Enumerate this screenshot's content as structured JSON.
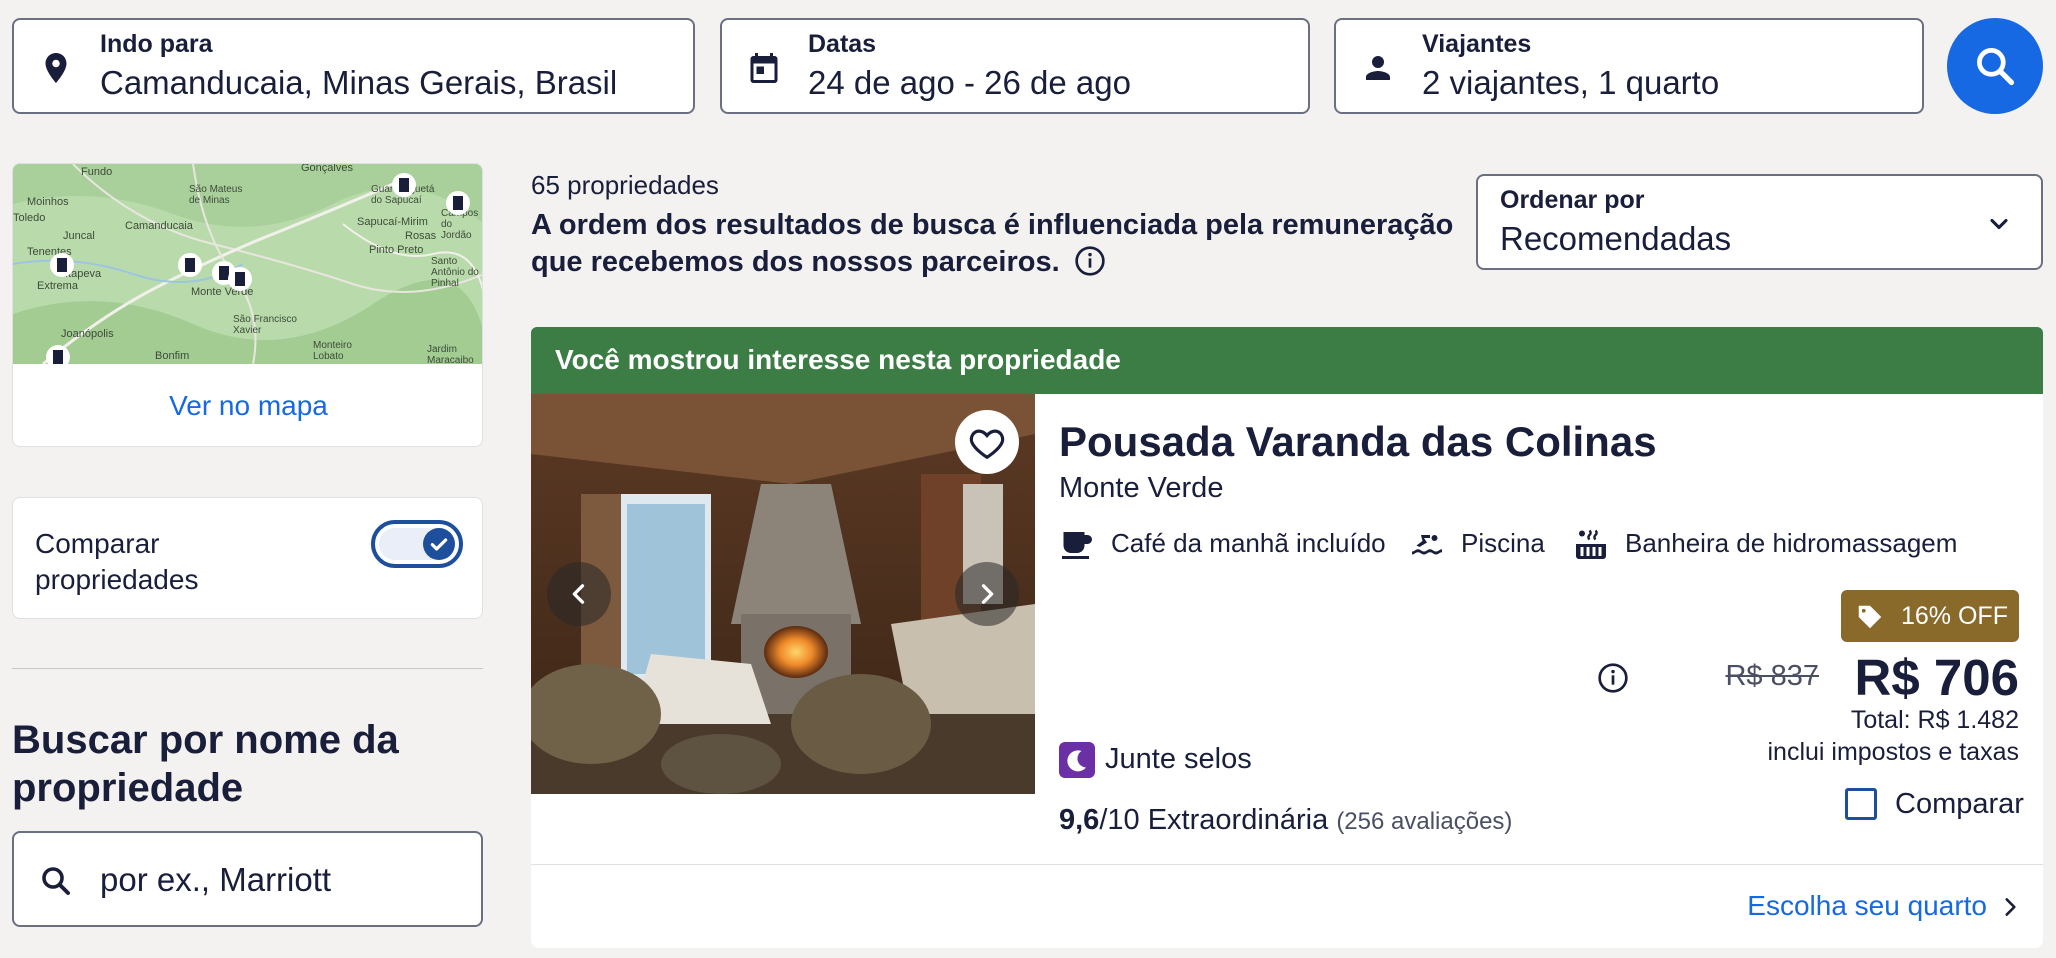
{
  "search": {
    "destination": {
      "label": "Indo para",
      "value": "Camanducaia, Minas Gerais, Brasil",
      "icon": "location-pin-icon"
    },
    "dates": {
      "label": "Datas",
      "value": "24 de ago - 26 de ago",
      "icon": "calendar-icon"
    },
    "travelers": {
      "label": "Viajantes",
      "value": "2 viajantes, 1 quarto",
      "icon": "person-icon"
    },
    "submit_icon": "search-icon"
  },
  "sidebar": {
    "map": {
      "link_label": "Ver no mapa",
      "places": [
        "Fundo",
        "Gonçalves",
        "São Mateus de Minas",
        "Campos do Jordão",
        "Moinhos",
        "Camanducaia",
        "Sapucaí-Mirim",
        "Rosas",
        "Toledo",
        "Juncal",
        "Pinto Preto",
        "Santo Antônio do Pinhal",
        "Tenentes",
        "Extrema",
        "Itapeva",
        "Monte Verde",
        "Joanópolis",
        "São Francisco Xavier",
        "Monteiro Lobato",
        "Jardim Maracaibo",
        "Bonfim",
        "Guaratinguetá do Sapucaí"
      ]
    },
    "compare": {
      "label": "Comparar propriedades",
      "enabled": true
    },
    "name_search": {
      "title": "Buscar por nome da propriedade",
      "placeholder": "por ex., Marriott"
    }
  },
  "results": {
    "count": "65 propriedades",
    "disclaimer": "A ordem dos resultados de busca é influenciada pela remuneração que recebemos dos nossos parceiros.",
    "sort": {
      "label": "Ordenar por",
      "value": "Recomendadas"
    }
  },
  "property": {
    "banner": "Você mostrou interesse nesta propriedade",
    "name": "Pousada Varanda das Colinas",
    "location": "Monte Verde",
    "amenities": [
      {
        "label": "Café da manhã incluído",
        "icon": "coffee-cup-icon"
      },
      {
        "label": "Piscina",
        "icon": "pool-icon"
      },
      {
        "label": "Banheira de hidromassagem",
        "icon": "hot-tub-icon"
      }
    ],
    "discount_badge": "16% OFF",
    "old_price": "R$ 837",
    "price": "R$ 706",
    "total": "Total: R$ 1.482",
    "taxes_note": "inclui impostos e taxas",
    "stamps_label": "Junte selos",
    "rating": {
      "score": "9,6",
      "scale": "/10",
      "label": "Extraordinária",
      "reviews": "(256 avaliações)"
    },
    "compare_label": "Comparar",
    "cta": "Escolha seu quarto"
  },
  "colors": {
    "brand_blue": "#1668e3",
    "banner_green": "#3c7c45",
    "discount_gold": "#8a6a2b",
    "stamps_purple": "#6b2fa6",
    "toggle_navy": "#1e4f9c"
  }
}
